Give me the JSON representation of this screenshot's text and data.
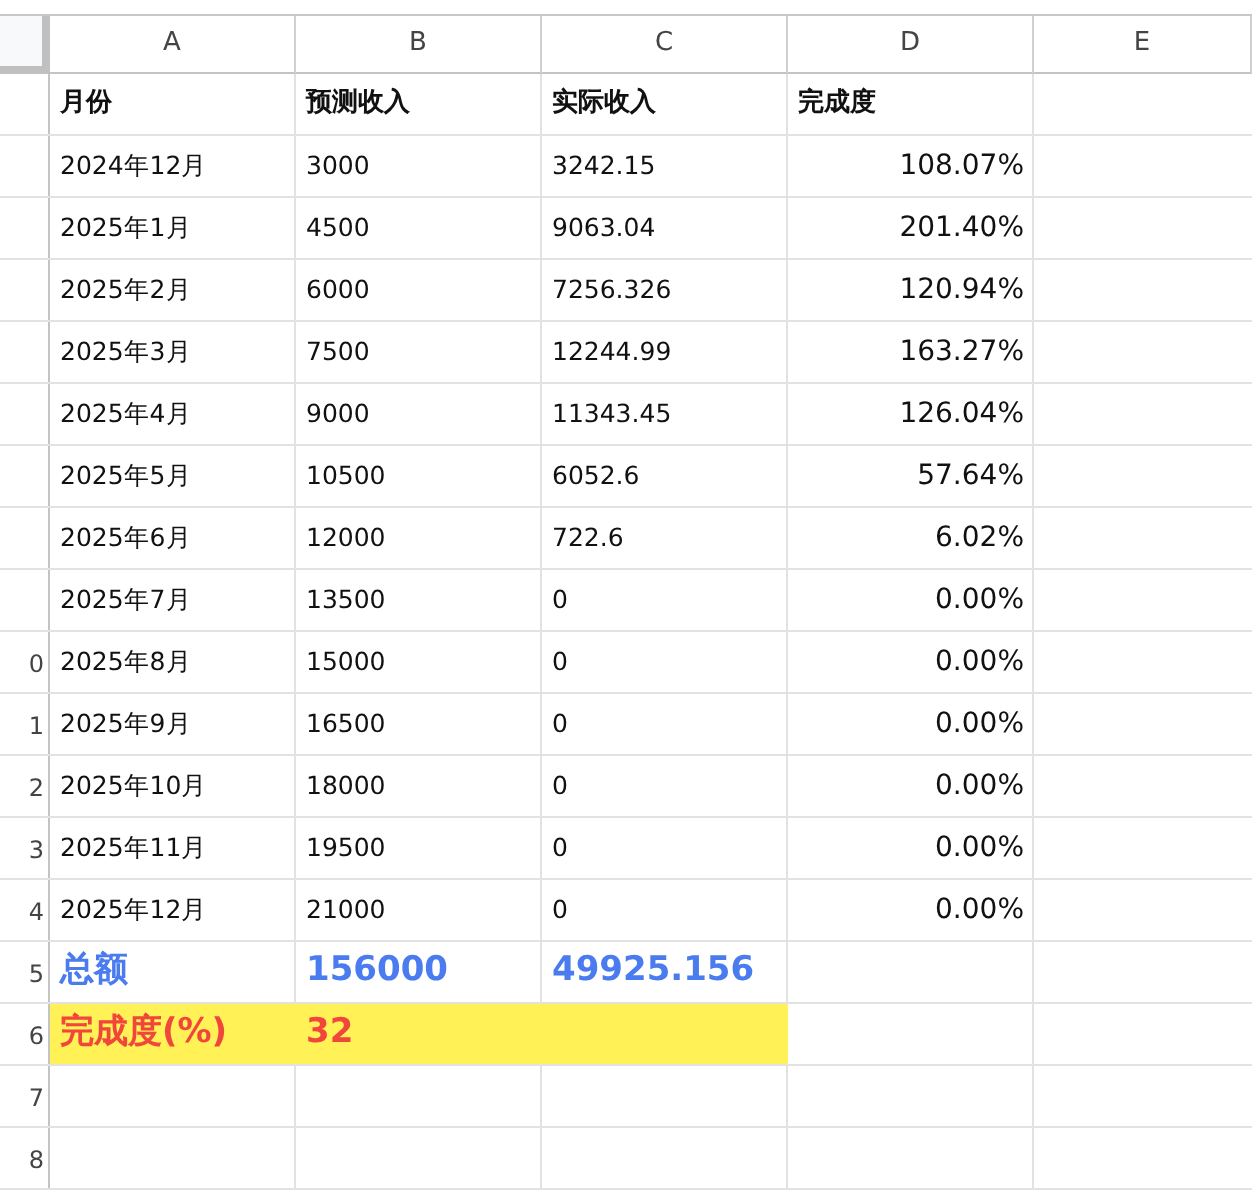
{
  "columns": [
    "A",
    "B",
    "C",
    "D",
    "E"
  ],
  "rows": [
    {
      "cells": [
        {
          "text": "月份",
          "kind": "header",
          "highlighted": false
        },
        {
          "text": "预测收入",
          "kind": "header",
          "highlighted": false
        },
        {
          "text": "实际收入",
          "kind": "header",
          "highlighted": false
        },
        {
          "text": "完成度",
          "kind": "header",
          "highlighted": false
        }
      ]
    },
    {
      "cells": [
        {
          "text": "2024年12月",
          "kind": "text",
          "highlighted": false
        },
        {
          "text": "3000",
          "kind": "text",
          "highlighted": false
        },
        {
          "text": "3242.15",
          "kind": "text",
          "highlighted": false
        },
        {
          "text": "108.07%",
          "kind": "percent",
          "highlighted": false
        }
      ]
    },
    {
      "cells": [
        {
          "text": "2025年1月",
          "kind": "text",
          "highlighted": false
        },
        {
          "text": "4500",
          "kind": "text",
          "highlighted": false
        },
        {
          "text": "9063.04",
          "kind": "text",
          "highlighted": false
        },
        {
          "text": "201.40%",
          "kind": "percent",
          "highlighted": false
        }
      ]
    },
    {
      "cells": [
        {
          "text": "2025年2月",
          "kind": "text",
          "highlighted": false
        },
        {
          "text": "6000",
          "kind": "text",
          "highlighted": false
        },
        {
          "text": "7256.326",
          "kind": "text",
          "highlighted": false
        },
        {
          "text": "120.94%",
          "kind": "percent",
          "highlighted": false
        }
      ]
    },
    {
      "cells": [
        {
          "text": "2025年3月",
          "kind": "text",
          "highlighted": false
        },
        {
          "text": "7500",
          "kind": "text",
          "highlighted": false
        },
        {
          "text": "12244.99",
          "kind": "text",
          "highlighted": false
        },
        {
          "text": "163.27%",
          "kind": "percent",
          "highlighted": false
        }
      ]
    },
    {
      "cells": [
        {
          "text": "2025年4月",
          "kind": "text",
          "highlighted": false
        },
        {
          "text": "9000",
          "kind": "text",
          "highlighted": false
        },
        {
          "text": "11343.45",
          "kind": "text",
          "highlighted": false
        },
        {
          "text": "126.04%",
          "kind": "percent",
          "highlighted": false
        }
      ]
    },
    {
      "cells": [
        {
          "text": "2025年5月",
          "kind": "text",
          "highlighted": false
        },
        {
          "text": "10500",
          "kind": "text",
          "highlighted": false
        },
        {
          "text": "6052.6",
          "kind": "text",
          "highlighted": false
        },
        {
          "text": "57.64%",
          "kind": "percent",
          "highlighted": false
        }
      ]
    },
    {
      "cells": [
        {
          "text": "2025年6月",
          "kind": "text",
          "highlighted": false
        },
        {
          "text": "12000",
          "kind": "text",
          "highlighted": false
        },
        {
          "text": "722.6",
          "kind": "text",
          "highlighted": false
        },
        {
          "text": "6.02%",
          "kind": "percent",
          "highlighted": false
        }
      ]
    },
    {
      "cells": [
        {
          "text": "2025年7月",
          "kind": "text",
          "highlighted": false
        },
        {
          "text": "13500",
          "kind": "text",
          "highlighted": false
        },
        {
          "text": "0",
          "kind": "text",
          "highlighted": false
        },
        {
          "text": "0.00%",
          "kind": "percent",
          "highlighted": false
        }
      ]
    },
    {
      "row_number": "0",
      "cells": [
        {
          "text": "2025年8月",
          "kind": "text",
          "highlighted": false
        },
        {
          "text": "15000",
          "kind": "text",
          "highlighted": false
        },
        {
          "text": "0",
          "kind": "text",
          "highlighted": false
        },
        {
          "text": "0.00%",
          "kind": "percent",
          "highlighted": false
        }
      ]
    },
    {
      "row_number": "1",
      "cells": [
        {
          "text": "2025年9月",
          "kind": "text",
          "highlighted": false
        },
        {
          "text": "16500",
          "kind": "text",
          "highlighted": false
        },
        {
          "text": "0",
          "kind": "text",
          "highlighted": false
        },
        {
          "text": "0.00%",
          "kind": "percent",
          "highlighted": false
        }
      ]
    },
    {
      "row_number": "2",
      "cells": [
        {
          "text": "2025年10月",
          "kind": "text",
          "highlighted": false
        },
        {
          "text": "18000",
          "kind": "text",
          "highlighted": false
        },
        {
          "text": "0",
          "kind": "text",
          "highlighted": false
        },
        {
          "text": "0.00%",
          "kind": "percent",
          "highlighted": false
        }
      ]
    },
    {
      "row_number": "3",
      "cells": [
        {
          "text": "2025年11月",
          "kind": "text",
          "highlighted": false
        },
        {
          "text": "19500",
          "kind": "text",
          "highlighted": false
        },
        {
          "text": "0",
          "kind": "text",
          "highlighted": false
        },
        {
          "text": "0.00%",
          "kind": "percent",
          "highlighted": false
        }
      ]
    },
    {
      "row_number": "4",
      "cells": [
        {
          "text": "2025年12月",
          "kind": "text",
          "highlighted": false
        },
        {
          "text": "21000",
          "kind": "text",
          "highlighted": false
        },
        {
          "text": "0",
          "kind": "text",
          "highlighted": false
        },
        {
          "text": "0.00%",
          "kind": "percent",
          "highlighted": false
        }
      ]
    },
    {
      "row_number": "5",
      "cells": [
        {
          "text": "总额",
          "kind": "total",
          "highlighted": false
        },
        {
          "text": "156000",
          "kind": "total",
          "highlighted": false
        },
        {
          "text": "49925.156",
          "kind": "total",
          "highlighted": false
        }
      ]
    },
    {
      "row_number": "6",
      "cells": [
        {
          "text": "完成度(%)",
          "kind": "rate",
          "highlighted": true
        },
        {
          "text": "32",
          "kind": "rate",
          "highlighted": true
        },
        {
          "kind": "empty",
          "highlighted": true
        }
      ]
    },
    {
      "row_number": "7"
    },
    {
      "row_number": "8"
    }
  ]
}
